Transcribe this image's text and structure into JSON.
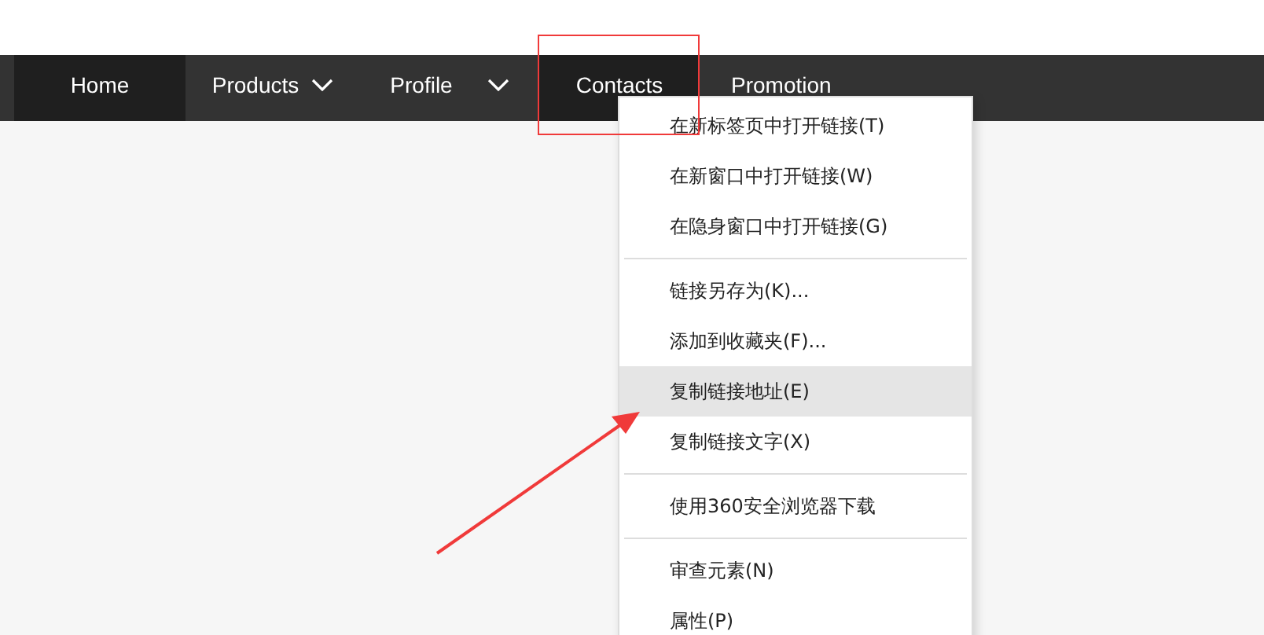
{
  "nav": [
    {
      "label": "Home",
      "dropdown": false,
      "active": true
    },
    {
      "label": "Products",
      "dropdown": true,
      "active": false
    },
    {
      "label": "Profile",
      "dropdown": true,
      "active": false
    },
    {
      "label": "Contacts",
      "dropdown": false,
      "active": true
    },
    {
      "label": "Promotion",
      "dropdown": false,
      "active": false
    }
  ],
  "context_menu": {
    "groups": [
      [
        {
          "label": "在新标签页中打开链接(T)",
          "selected": false
        },
        {
          "label": "在新窗口中打开链接(W)",
          "selected": false
        },
        {
          "label": "在隐身窗口中打开链接(G)",
          "selected": false
        }
      ],
      [
        {
          "label": "链接另存为(K)...",
          "selected": false
        },
        {
          "label": "添加到收藏夹(F)...",
          "selected": false
        },
        {
          "label": "复制链接地址(E)",
          "selected": true
        },
        {
          "label": "复制链接文字(X)",
          "selected": false
        }
      ],
      [
        {
          "label": "使用360安全浏览器下载",
          "selected": false
        }
      ],
      [
        {
          "label": "审查元素(N)",
          "selected": false
        },
        {
          "label": "属性(P)",
          "selected": false
        }
      ]
    ]
  }
}
